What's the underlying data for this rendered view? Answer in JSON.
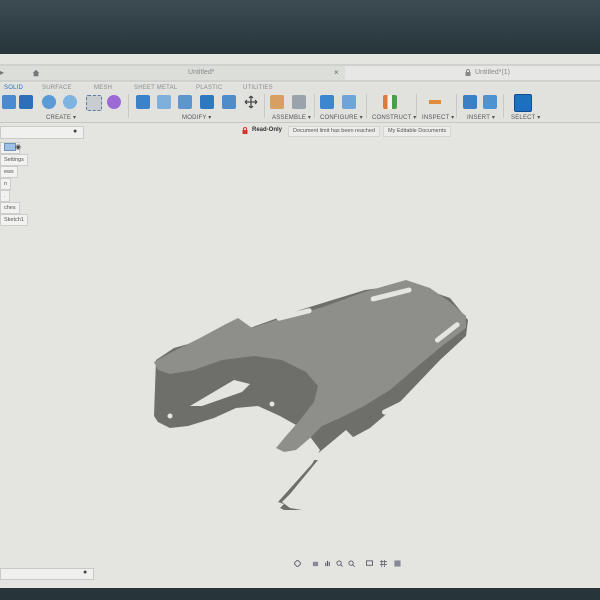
{
  "window": {
    "doc_tab_left": "Untitled*",
    "doc_tab_right": "Untitled*(1)"
  },
  "ribbon": {
    "groups": [
      {
        "title": "SOLID",
        "menu": "CREATE ▾"
      },
      {
        "title": "SURFACE",
        "menu": ""
      },
      {
        "title": "MESH",
        "menu": ""
      },
      {
        "title": "SHEET METAL",
        "menu": "MODIFY ▾"
      },
      {
        "title": "PLASTIC",
        "menu": ""
      },
      {
        "title": "UTILITIES",
        "menu": "ASSEMBLE ▾"
      }
    ],
    "menus_extra": [
      "CONFIGURE ▾",
      "CONSTRUCT ▾",
      "INSPECT ▾",
      "INSERT ▾",
      "SELECT ▾"
    ],
    "accent": "#2a6fb5"
  },
  "status": {
    "read_only": "Read-Only",
    "limit_msg": "Document limit has been reached",
    "editable_docs": "My Editable Documents"
  },
  "browser": {
    "items": [
      "Settings",
      "ews",
      "n",
      "ches",
      "Sketch1"
    ]
  },
  "model": {
    "color": "#8e8e8b",
    "edge_color": "#6e6e6b"
  }
}
